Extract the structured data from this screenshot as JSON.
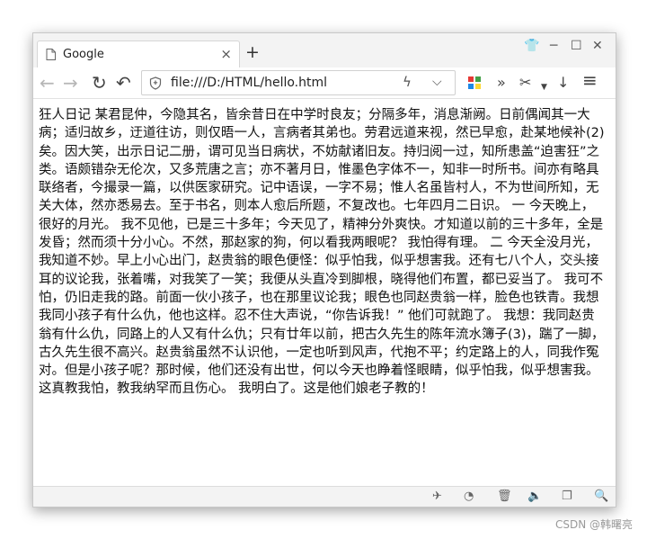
{
  "tab": {
    "title": "Google",
    "close_label": "×",
    "new_tab_label": "+"
  },
  "window_controls": {
    "shirt_label": "👕",
    "minimize_label": "─",
    "maximize_label": "☐",
    "close_label": "✕"
  },
  "toolbar": {
    "back_label": "←",
    "forward_label": "→",
    "reload_label": "↻",
    "undo_label": "↶",
    "bolt_label": "ϟ",
    "dropdown_label": "⌵",
    "overflow_label": "»",
    "cut_label": "✂",
    "download_label": "↓",
    "menu_label": "≡"
  },
  "address_bar": {
    "url": "file:///D:/HTML/hello.html"
  },
  "page": {
    "text": "狂人日记 某君昆仲，今隐其名，皆余昔日在中学时良友；分隔多年，消息渐阙。日前偶闻其一大病；适归故乡，迂道往访，则仅晤一人，言病者其弟也。劳君远道来视，然已早愈，赴某地候补(2)矣。因大笑，出示日记二册，谓可见当日病状，不妨献诸旧友。持归阅一过，知所患盖“迫害狂”之类。语颇错杂无伦次，又多荒唐之言；亦不著月日，惟墨色字体不一，知非一时所书。间亦有略具联络者，今撮录一篇，以供医家研究。记中语误，一字不易；惟人名虽皆村人，不为世间所知，无关大体，然亦悉易去。至于书名，则本人愈后所题，不复改也。七年四月二日识。 一 今天晚上，很好的月光。 我不见他，已是三十多年；今天见了，精神分外爽快。才知道以前的三十多年，全是发昏；然而须十分小心。不然，那赵家的狗，何以看我两眼呢？ 我怕得有理。 二 今天全没月光，我知道不妙。早上小心出门，赵贵翁的眼色便怪：似乎怕我，似乎想害我。还有七八个人，交头接耳的议论我，张着嘴，对我笑了一笑；我便从头直冷到脚根，晓得他们布置，都已妥当了。 我可不怕，仍旧走我的路。前面一伙小孩子，也在那里议论我；眼色也同赵贵翁一样，脸色也铁青。我想我同小孩子有什么仇，他也这样。忍不住大声说，“你告诉我！” 他们可就跑了。 我想：我同赵贵翁有什么仇，同路上的人又有什么仇；只有廿年以前，把古久先生的陈年流水簿子(3)，踹了一脚，古久先生很不高兴。赵贵翁虽然不认识他，一定也听到风声，代抱不平；约定路上的人，同我作冤对。但是小孩子呢？那时候，他们还没有出世，何以今天也睁着怪眼睛，似乎怕我，似乎想害我。这真教我怕，教我纳罕而且伤心。 我明白了。这是他们娘老子教的！"
  },
  "watermark": "CSDN @韩曙亮"
}
